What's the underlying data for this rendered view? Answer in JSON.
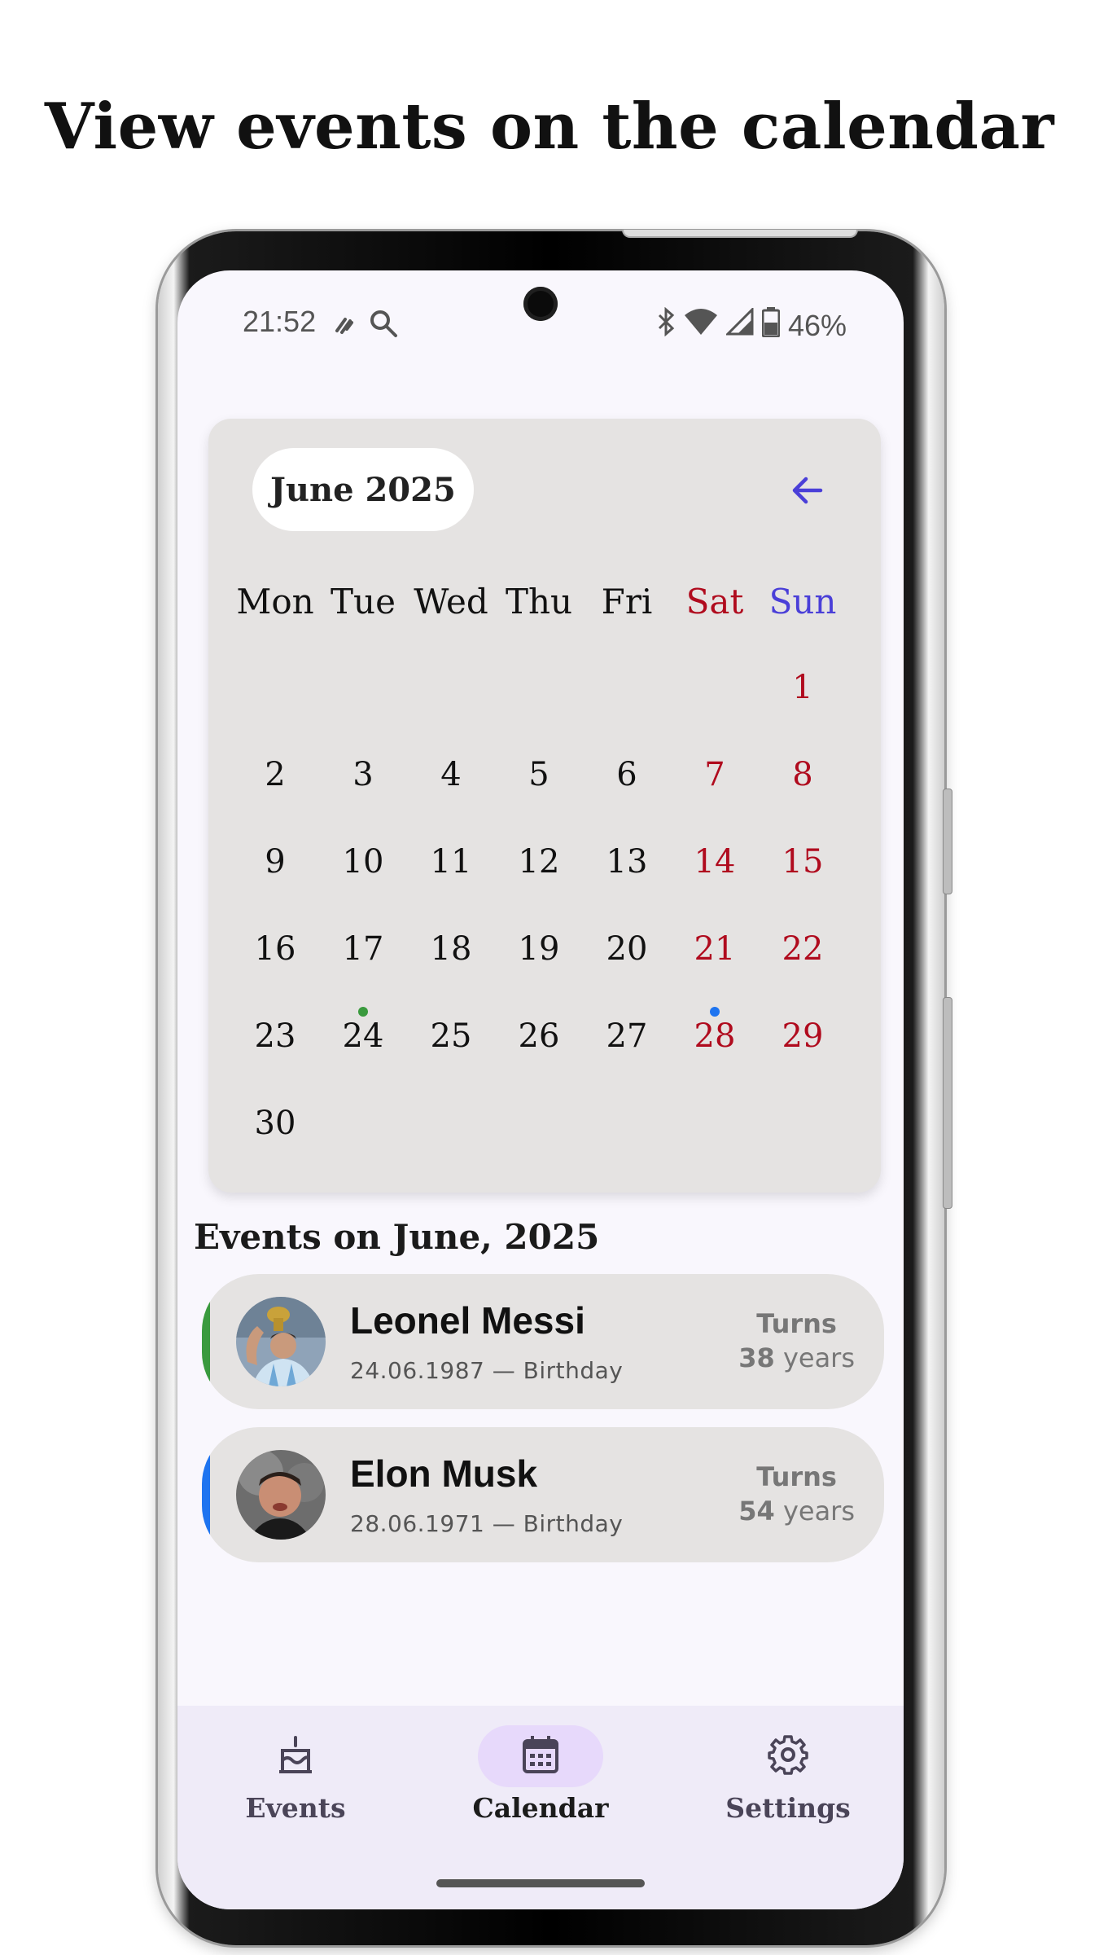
{
  "headline": "View events on the calendar",
  "status_bar": {
    "time": "21:52",
    "battery_percent": "46%",
    "left_icons": [
      "swipe-icon",
      "search-icon"
    ],
    "right_icons": [
      "bluetooth-icon",
      "wifi-icon",
      "cell-signal-icon",
      "battery-icon"
    ]
  },
  "calendar": {
    "month_label": "June 2025",
    "weekdays": [
      "Mon",
      "Tue",
      "Wed",
      "Thu",
      "Fri",
      "Sat",
      "Sun"
    ],
    "weeks": [
      [
        "",
        "",
        "",
        "",
        "",
        "",
        "1"
      ],
      [
        "2",
        "3",
        "4",
        "5",
        "6",
        "7",
        "8"
      ],
      [
        "9",
        "10",
        "11",
        "12",
        "13",
        "14",
        "15"
      ],
      [
        "16",
        "17",
        "18",
        "19",
        "20",
        "21",
        "22"
      ],
      [
        "23",
        "24",
        "25",
        "26",
        "27",
        "28",
        "29"
      ],
      [
        "30",
        "",
        "",
        "",
        "",
        "",
        ""
      ]
    ],
    "event_markers": [
      {
        "day": "24",
        "color": "#3a9a3e"
      },
      {
        "day": "28",
        "color": "#1e74f0"
      }
    ],
    "colors": {
      "weekend": "#b00b1e",
      "sunday_header": "#4a3fd8",
      "arrow": "#4a3fd8"
    }
  },
  "events_section": {
    "title": "Events on June, 2025",
    "events": [
      {
        "name": "Leonel Messi",
        "subtitle": "24.06.1987 — Birthday",
        "turns_label": "Turns",
        "age_number": "38",
        "age_unit": "years",
        "accent_color": "#3a9a3e"
      },
      {
        "name": "Elon Musk",
        "subtitle": "28.06.1971 — Birthday",
        "turns_label": "Turns",
        "age_number": "54",
        "age_unit": "years",
        "accent_color": "#1e74f0"
      }
    ]
  },
  "bottom_nav": {
    "items": [
      {
        "label": "Events",
        "icon": "cake-icon",
        "active": false
      },
      {
        "label": "Calendar",
        "icon": "calendar-icon",
        "active": true
      },
      {
        "label": "Settings",
        "icon": "gear-icon",
        "active": false
      }
    ],
    "active_pill_color": "#e7d9fb"
  }
}
